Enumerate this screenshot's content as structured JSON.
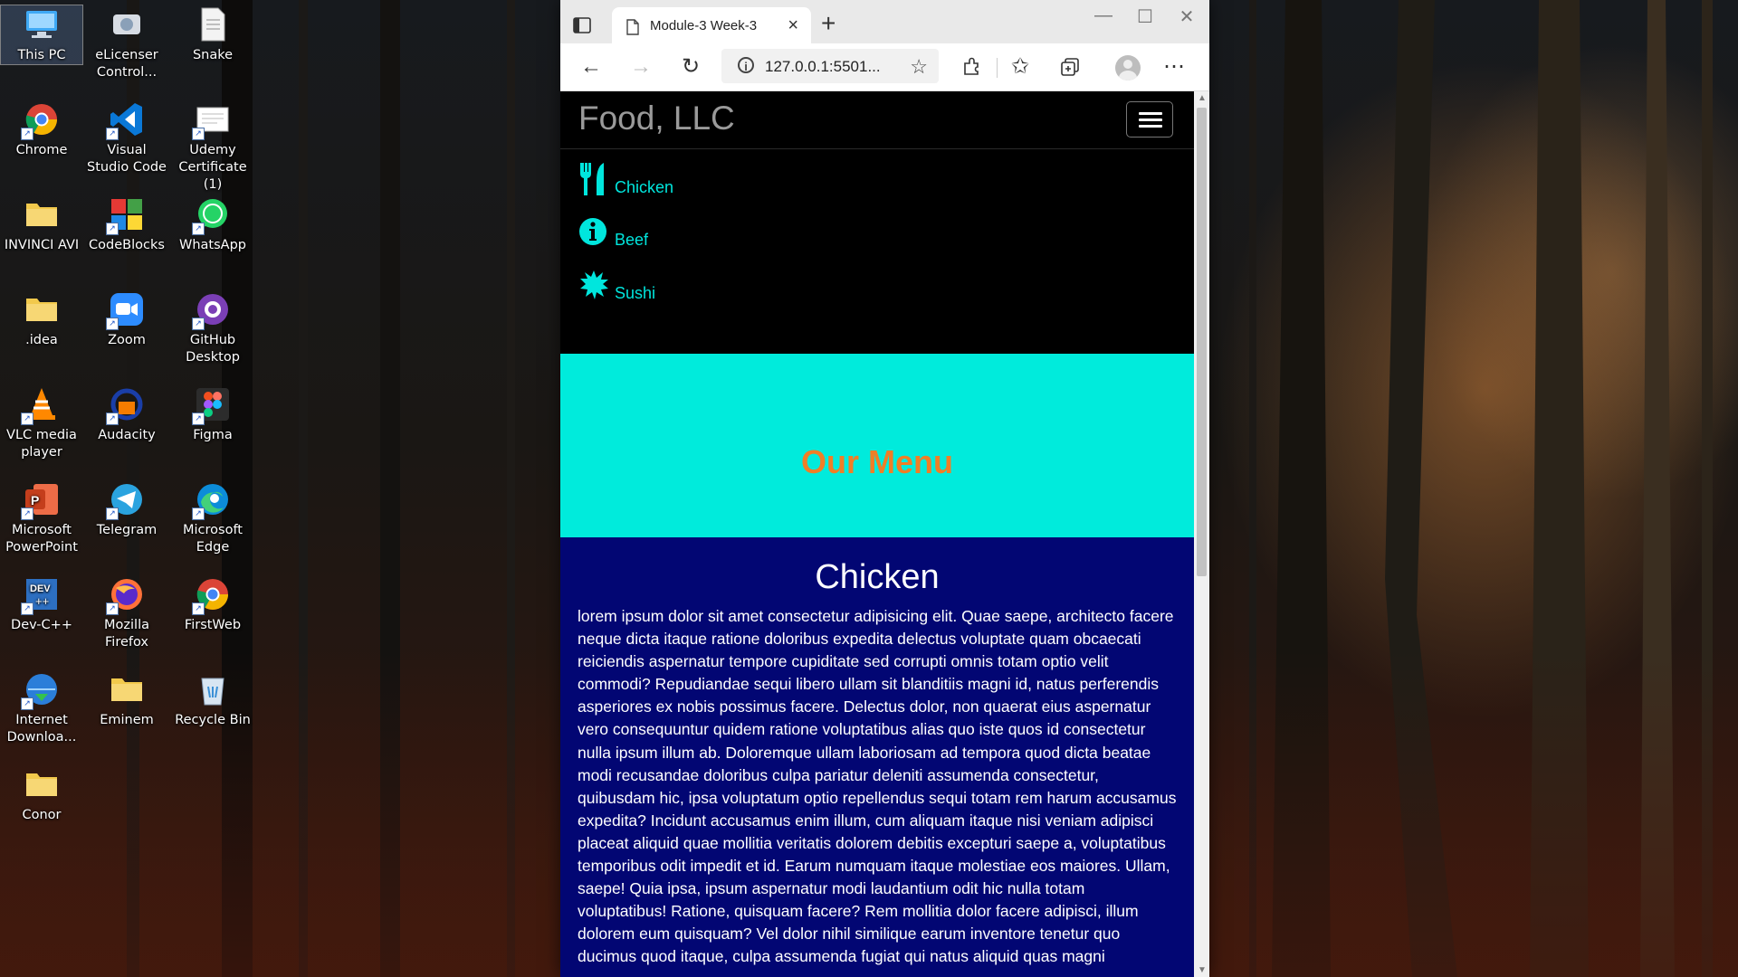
{
  "desktop": {
    "icons": [
      {
        "label": "This PC",
        "icon": "computer-icon",
        "selected": true
      },
      {
        "label": "eLicenser Control...",
        "icon": "elicenser-icon"
      },
      {
        "label": "Snake",
        "icon": "text-file-icon"
      },
      {
        "label": "Chrome",
        "icon": "chrome-icon"
      },
      {
        "label": "Visual Studio Code",
        "icon": "vscode-icon"
      },
      {
        "label": "Udemy Certificate (1)",
        "icon": "certificate-file-icon"
      },
      {
        "label": "INVINCI AVI",
        "icon": "folder-icon"
      },
      {
        "label": "CodeBlocks",
        "icon": "codeblocks-icon"
      },
      {
        "label": "WhatsApp",
        "icon": "whatsapp-icon"
      },
      {
        "label": ".idea",
        "icon": "folder-icon"
      },
      {
        "label": "Zoom",
        "icon": "zoom-icon"
      },
      {
        "label": "GitHub Desktop",
        "icon": "github-desktop-icon"
      },
      {
        "label": "VLC media player",
        "icon": "vlc-icon"
      },
      {
        "label": "Audacity",
        "icon": "audacity-icon"
      },
      {
        "label": "Figma",
        "icon": "figma-icon"
      },
      {
        "label": "Microsoft PowerPoint",
        "icon": "powerpoint-icon"
      },
      {
        "label": "Telegram",
        "icon": "telegram-icon"
      },
      {
        "label": "Microsoft Edge",
        "icon": "edge-icon"
      },
      {
        "label": "Dev-C++",
        "icon": "devcpp-icon"
      },
      {
        "label": "Mozilla Firefox",
        "icon": "firefox-icon"
      },
      {
        "label": "FirstWeb",
        "icon": "chrome-icon"
      },
      {
        "label": "Internet Downloa...",
        "icon": "internet-download-manager-icon"
      },
      {
        "label": "Eminem",
        "icon": "folder-icon"
      },
      {
        "label": "Recycle Bin",
        "icon": "recycle-bin-icon"
      },
      {
        "label": "Conor",
        "icon": "folder-icon"
      }
    ]
  },
  "browser": {
    "tab_title": "Module-3 Week-3",
    "address": "127.0.0.1:5501...",
    "new_tab_symbol": "+",
    "close_tab_symbol": "×"
  },
  "page": {
    "brand": "Food, LLC",
    "nav": [
      {
        "label": "Chicken",
        "icon": "fork-knife-icon"
      },
      {
        "label": "Beef",
        "icon": "info-circle-icon"
      },
      {
        "label": "Sushi",
        "icon": "starburst-icon"
      }
    ],
    "jumbotron_title": "Our Menu",
    "section_title": "Chicken",
    "section_text": "lorem ipsum dolor sit amet consectetur adipisicing elit. Quae saepe, architecto facere neque dicta itaque ratione doloribus expedita delectus voluptate quam obcaecati reiciendis aspernatur tempore cupiditate sed corrupti omnis totam optio velit commodi? Repudiandae sequi libero ullam sit blanditiis magni id, natus perferendis asperiores ex nobis possimus facere. Delectus dolor, non quaerat eius aspernatur vero consequuntur quidem ratione voluptatibus alias quo iste quos id consectetur nulla ipsum illum ab. Doloremque ullam laboriosam ad tempora quod dicta beatae modi recusandae doloribus culpa pariatur deleniti assumenda consectetur, quibusdam hic, ipsa voluptatum optio repellendus sequi totam rem harum accusamus expedita? Incidunt accusamus enim illum, cum aliquam itaque nisi veniam adipisci placeat aliquid quae mollitia veritatis dolorem debitis excepturi saepe a, voluptatibus temporibus odit impedit et id. Earum numquam itaque molestiae eos maiores. Ullam, saepe! Quia ipsa, ipsum aspernatur modi laudantium odit hic nulla totam voluptatibus! Ratione, quisquam facere? Rem mollitia dolor facere adipisci, illum dolorem eum quisquam? Vel dolor nihil similique earum inventore tenetur quo ducimus quod itaque, culpa assumenda fugiat qui natus aliquid quas magni",
    "colors": {
      "nav_link": "#00e6dd",
      "jumbotron_bg": "#00ebdc",
      "jumbotron_text": "#f07e26",
      "section_bg": "#020673"
    }
  }
}
